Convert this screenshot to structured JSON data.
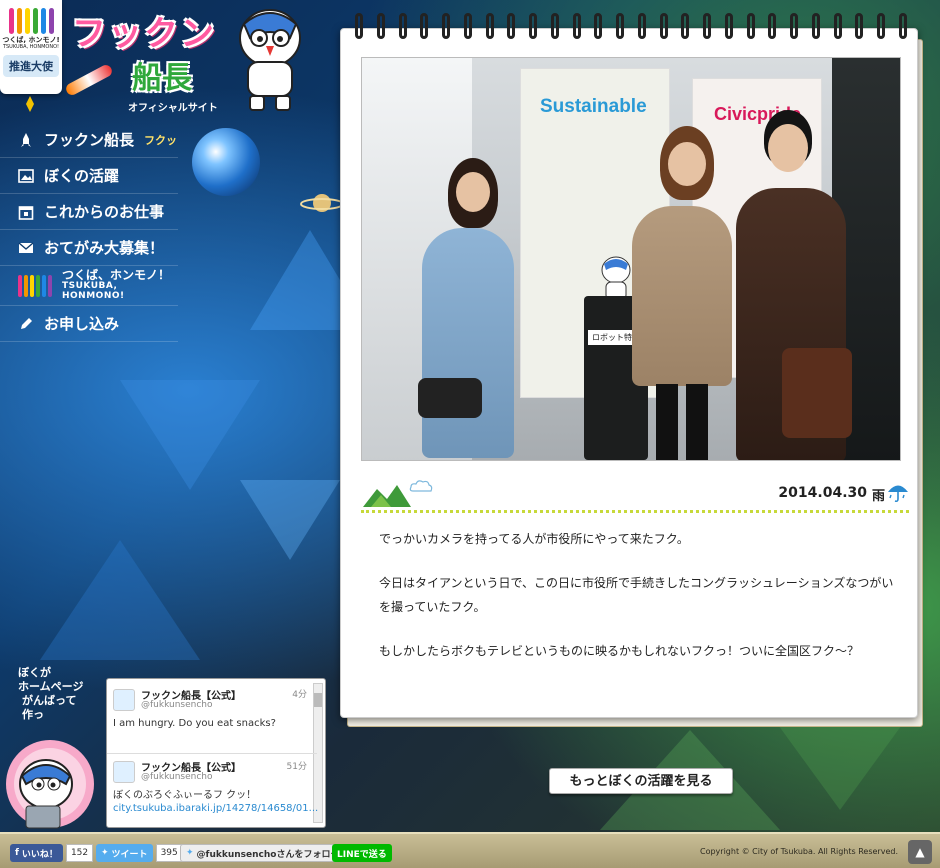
{
  "brand": {
    "small_logo": "つくば, ホンモノ!",
    "small_logo_sub": "TSUKUBA, HONMONO!",
    "tag": "推進大使",
    "bar_colors": [
      "#e8338a",
      "#f29600",
      "#ffd400",
      "#3aa935",
      "#1e88e5",
      "#8e44ad"
    ]
  },
  "logo": {
    "line1": "フックン",
    "line2": "船長",
    "subtitle": "オフィシャルサイト"
  },
  "nav": {
    "items": [
      {
        "label": "フックン船長",
        "sub": "フクッ",
        "icon": "rocket-icon"
      },
      {
        "label": "ぼくの活躍",
        "icon": "photo-icon"
      },
      {
        "label": "これからのお仕事",
        "icon": "calendar-icon"
      },
      {
        "label": "おてがみ大募集！",
        "icon": "envelope-icon"
      },
      {
        "label": "つくば、ホンモノ！",
        "sub": "TSUKUBA, HONMONO!",
        "icon": "honmono-logo"
      },
      {
        "label": "お申し込み",
        "icon": "pencil-icon"
      }
    ]
  },
  "photo": {
    "sign1": "Sustainable",
    "sign2": "Civicpride",
    "robot_sign": "ロボット特区"
  },
  "entry": {
    "date": "2014.04.30",
    "weather": "雨",
    "paragraphs": [
      "でっかいカメラを持ってる人が市役所にやって来たフク。",
      "今日はタイアンという日で、この日に市役所で手続きしたコングラッシュレーションズなつがいを撮っていたフク。",
      "もしかしたらボクもテレビというものに映るかもしれないフクっ！ついに全国区フク～？"
    ]
  },
  "more_button": "もっとぼくの活躍を見る",
  "speech": [
    "ぼくが",
    "ホームページ",
    "がんばって",
    "作っ"
  ],
  "twitter": {
    "tweets": [
      {
        "name": "フックン船長【公式】",
        "handle": "@fukkunsencho",
        "time": "4分",
        "text": "I am hungry. Do you eat snacks?",
        "link": ""
      },
      {
        "name": "フックン船長【公式】",
        "handle": "@fukkunsencho",
        "time": "51分",
        "text": "ぼくのぶろぐふぃーるフ クッ！",
        "link": "city.tsukuba.ibaraki.jp/14278/14658/01..."
      }
    ]
  },
  "footer": {
    "like_label": "いいね！",
    "like_count": "152",
    "tweet_label": "ツイート",
    "tweet_count": "395",
    "follow_label": "@fukkunsenchoさんをフォロー",
    "line_label": "LINEで送る",
    "copyright": "Copyright © City of Tsukuba. All Rights Reserved."
  },
  "colors": {
    "logo_pink": "#ff5aa0",
    "logo_green": "#2fa83b",
    "accent_dots": "#c7d93a",
    "facebook": "#3b5998",
    "twitter": "#55acee",
    "line": "#00b900"
  }
}
